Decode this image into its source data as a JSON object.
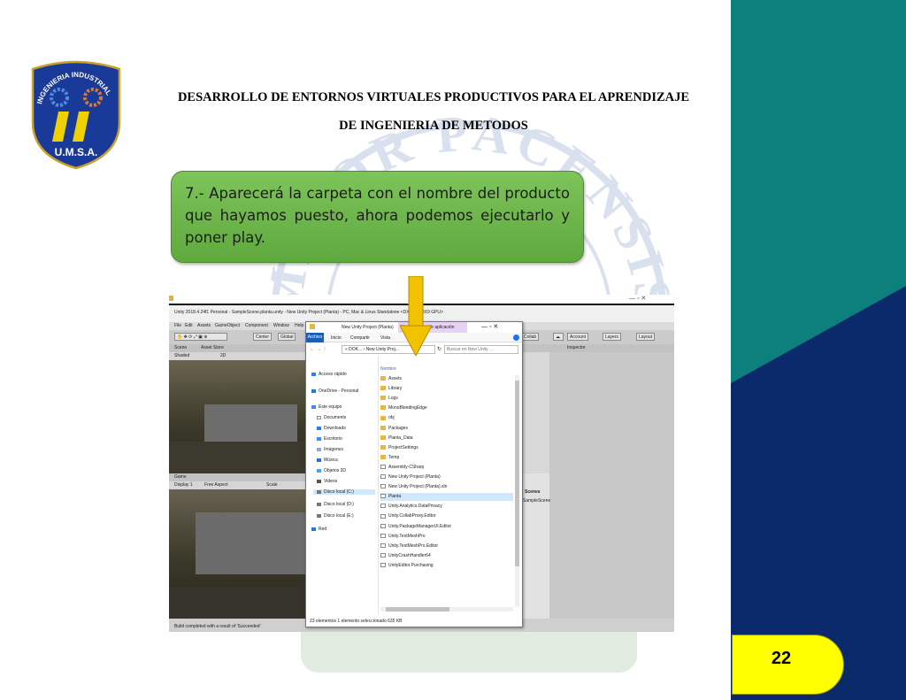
{
  "header": {
    "line1": "DESARROLLO DE ENTORNOS VIRTUALES PRODUCTIVOS PARA EL APRENDIZAJE",
    "line2": "DE INGENIERIA DE METODOS"
  },
  "logo": {
    "arc_text": "INGENIERIA INDUSTRIAL",
    "bottom_text": "U.M.S.A."
  },
  "watermark": {
    "arc_text": "MAJOR PACENSIS"
  },
  "callout": {
    "text": "7.- Aparecerá la carpeta con el nombre del producto que hayamos puesto, ahora podemos ejecutarlo y poner play."
  },
  "page_number": "22",
  "colors": {
    "teal": "#0d7f7c",
    "navy": "#0b2a6b",
    "callout_green": "#6ab64a",
    "page_badge": "#ffff00"
  },
  "screenshot": {
    "unity_title": "Unity 2018.4.24f1 Personal - SampleScene.planta.unity - New Unity Project (Planta) - PC, Mac & Linux Standalone <DX11 on DX9 GPU>",
    "unity_menu": [
      "File",
      "Edit",
      "Assets",
      "GameObject",
      "Component",
      "Window",
      "Help"
    ],
    "toolbar": {
      "center": "Center",
      "global": "Global",
      "collab": "Collab",
      "account": "Account",
      "layers": "Layers",
      "layout": "Layout"
    },
    "scene_tab": "Scene",
    "asset_store_tab": "Asset Store",
    "shaded": "Shaded",
    "mode_2d": "2D",
    "game_tab": "Game",
    "display": "Display 1",
    "aspect": "Free Aspect",
    "scale": "Scale",
    "inspector_tab": "Inspector",
    "scenes_label": "Scenes",
    "sample_scene": "SampleScene",
    "status_bar": "Build completed with a result of 'Succeeded'",
    "explorer": {
      "title": "New Unity Project (Planta)",
      "ribbon_tag": "Herramientas de aplicación",
      "ribbon_tabs": [
        "Archivo",
        "Inicio",
        "Compartir",
        "Vista"
      ],
      "path": "« DOK... › New Unity Proj...",
      "search_placeholder": "Buscar en New Unity ...",
      "column_header": "Nombre",
      "nav_items": [
        "Acceso rápido",
        "OneDrive - Personal",
        "Este equipo",
        "Documents",
        "Downloads",
        "Escritorio",
        "Imágenes",
        "Música",
        "Objetos 3D",
        "Videos",
        "Disco local (C:)",
        "Disco local (D:)",
        "Disco local (E:)",
        "Red"
      ],
      "files": [
        {
          "name": "Assets",
          "kind": "folder"
        },
        {
          "name": "Library",
          "kind": "folder"
        },
        {
          "name": "Logs",
          "kind": "folder"
        },
        {
          "name": "MonoBleedingEdge",
          "kind": "folder"
        },
        {
          "name": "obj",
          "kind": "folder"
        },
        {
          "name": "Packages",
          "kind": "folder"
        },
        {
          "name": "Planta_Data",
          "kind": "folder"
        },
        {
          "name": "ProjectSettings",
          "kind": "folder"
        },
        {
          "name": "Temp",
          "kind": "folder"
        },
        {
          "name": "Assembly-CSharp",
          "kind": "file"
        },
        {
          "name": "New Unity Project (Planta)",
          "kind": "file"
        },
        {
          "name": "New Unity Project (Planta).sln",
          "kind": "file"
        },
        {
          "name": "Planta",
          "kind": "file"
        },
        {
          "name": "Unity.Analytics.DataPrivacy",
          "kind": "file"
        },
        {
          "name": "Unity.CollabProxy.Editor",
          "kind": "file"
        },
        {
          "name": "Unity.PackageManagerUI.Editor",
          "kind": "file"
        },
        {
          "name": "Unity.TextMeshPro",
          "kind": "file"
        },
        {
          "name": "Unity.TextMeshPro.Editor",
          "kind": "file"
        },
        {
          "name": "UnityCrashHandler64",
          "kind": "file"
        },
        {
          "name": "UnityEditor.Purchasing",
          "kind": "file"
        }
      ],
      "status": "23 elementos     1 elemento seleccionado 635 KB"
    }
  }
}
